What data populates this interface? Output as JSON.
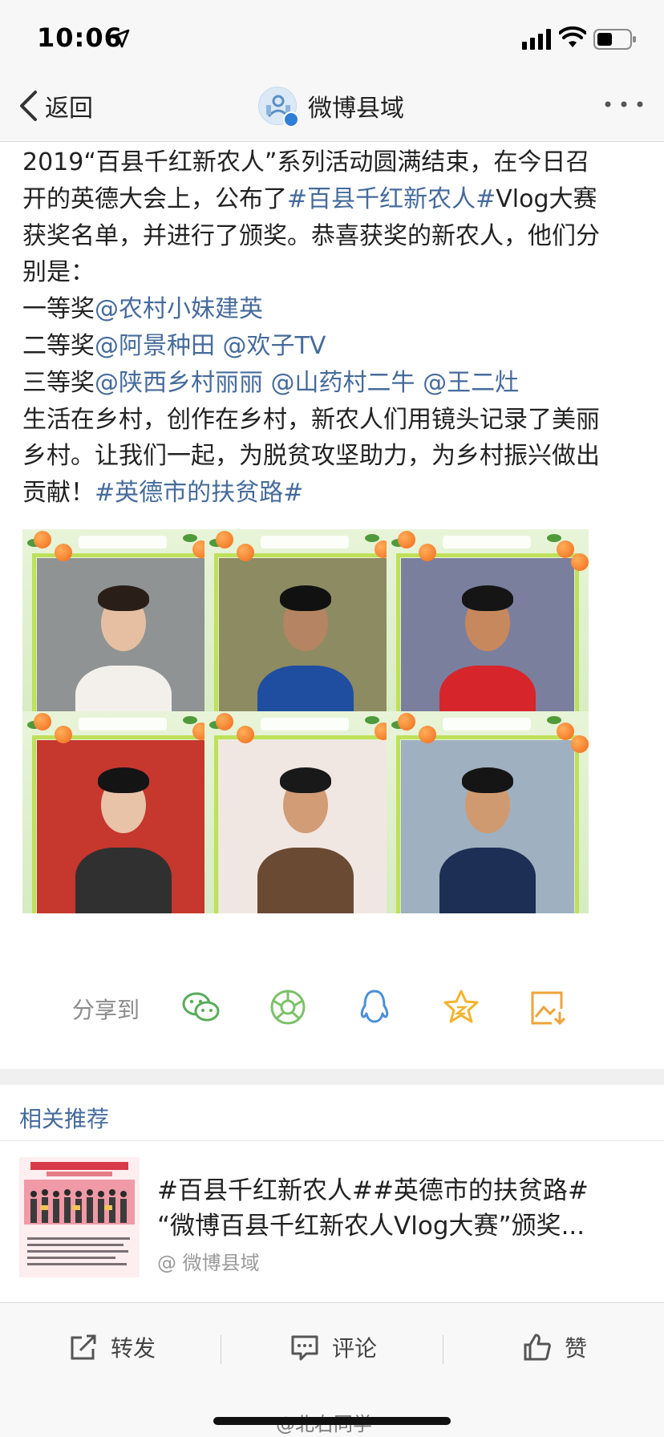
{
  "status_bar": {
    "time": "10:06"
  },
  "nav": {
    "back_label": "返回",
    "title": "微博县域"
  },
  "post": {
    "lines": [
      [
        {
          "t": "2019“百县千红新农人”系列活动圆满结束，在今日召"
        }
      ],
      [
        {
          "t": "开的英德大会上，公布了"
        },
        {
          "t": "#百县千红新农人#",
          "link": true
        },
        {
          "t": "Vlog大赛"
        }
      ],
      [
        {
          "t": "获奖名单，并进行了颁奖。恭喜获奖的新农人，他们分"
        }
      ],
      [
        {
          "t": "别是："
        }
      ],
      [
        {
          "t": "一等奖"
        },
        {
          "t": "@农村小妹建英",
          "link": true
        }
      ],
      [
        {
          "t": "二等奖"
        },
        {
          "t": "@阿景种田",
          "link": true
        },
        {
          "t": " "
        },
        {
          "t": "@欢子TV",
          "link": true
        }
      ],
      [
        {
          "t": "三等奖"
        },
        {
          "t": "@陕西乡村丽丽",
          "link": true
        },
        {
          "t": " "
        },
        {
          "t": "@山药村二牛",
          "link": true
        },
        {
          "t": " "
        },
        {
          "t": "@王二灶",
          "link": true
        }
      ],
      [
        {
          "t": "生活在乡村，创作在乡村，新农人们用镜头记录了美丽"
        }
      ],
      [
        {
          "t": "乡村。让我们一起，为脱贫攻坚助力，为乡村振兴做出"
        }
      ],
      [
        {
          "t": "贡献！"
        },
        {
          "t": "#英德市的扶贫路#",
          "link": true
        }
      ]
    ]
  },
  "photos": [
    {
      "name": "photo-woman-white-shirt",
      "bg": "#8f9393",
      "skin": "#e6bfa3",
      "hair": "#2a1f18",
      "shirt": "#f3f0ec"
    },
    {
      "name": "photo-man-blue-jacket",
      "bg": "#8d8b62",
      "skin": "#b58462",
      "hair": "#111111",
      "shirt": "#1f4ea1"
    },
    {
      "name": "photo-man-red-tank",
      "bg": "#7b7f9e",
      "skin": "#c7885d",
      "hair": "#151515",
      "shirt": "#d6262b"
    },
    {
      "name": "photo-woman-street",
      "bg": "#c6372e",
      "skin": "#e8c3a8",
      "hair": "#141414",
      "shirt": "#303030"
    },
    {
      "name": "photo-man-brown-vest",
      "bg": "#f1e7e2",
      "skin": "#d29c76",
      "hair": "#191919",
      "shirt": "#6a4a33"
    },
    {
      "name": "photo-man-tea-basket",
      "bg": "#9fb0c0",
      "skin": "#d09a70",
      "hair": "#151515",
      "shirt": "#1e2f55"
    }
  ],
  "share": {
    "label": "分享到",
    "icons": [
      "wechat-icon",
      "moments-icon",
      "qq-icon",
      "favorite-icon",
      "save-image-icon"
    ],
    "colors": {
      "wechat": "#5aac5a",
      "moments": "#7cc168",
      "qq": "#4b8fd6",
      "favorite": "#f2b42c",
      "save": "#f0a33a"
    }
  },
  "related": {
    "title": "相关推荐",
    "line1": "#百县千红新农人##英德市的扶贫路#",
    "line2": "“微博百县千红新农人Vlog大赛”颁奖...",
    "author": "@ 微博县域"
  },
  "actions": {
    "repost": "转发",
    "comment": "评论",
    "like": "赞"
  },
  "watermark": "@北右同学",
  "colors": {
    "link": "#466b9c",
    "text": "#222222",
    "frame": "#bfe05a"
  }
}
